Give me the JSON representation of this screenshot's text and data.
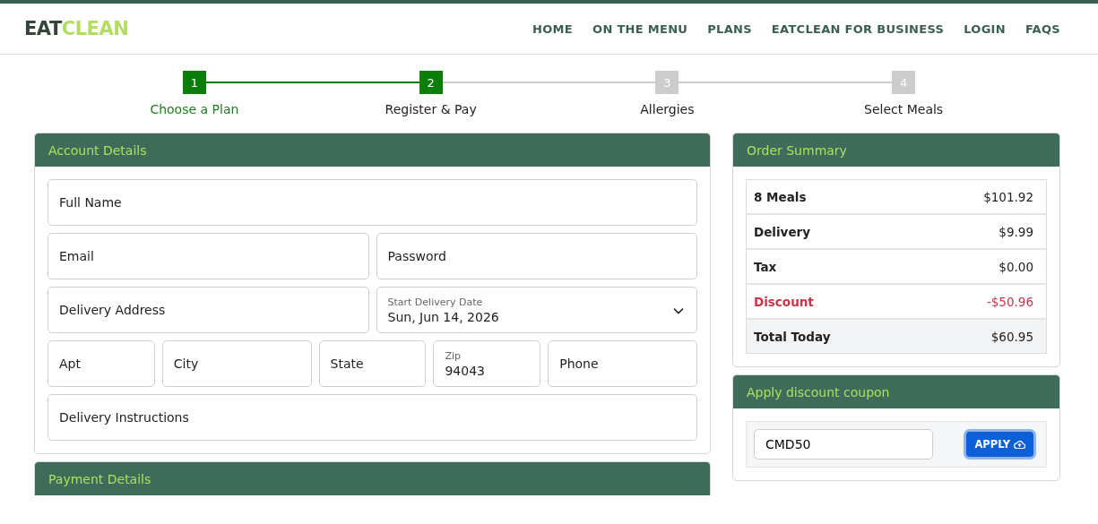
{
  "logo": {
    "dark": "EAT",
    "light": "CLEAN"
  },
  "nav": [
    "HOME",
    "ON THE MENU",
    "PLANS",
    "EATCLEAN FOR BUSINESS",
    "LOGIN",
    "FAQS"
  ],
  "steps": [
    {
      "number": "1",
      "label": "Choose a Plan",
      "done": true
    },
    {
      "number": "2",
      "label": "Register & Pay",
      "done": true
    },
    {
      "number": "3",
      "label": "Allergies",
      "done": false
    },
    {
      "number": "4",
      "label": "Select Meals",
      "done": false
    }
  ],
  "account": {
    "title": "Account Details",
    "rows": [
      [
        {
          "kind": "text",
          "placeholder": "Full Name"
        }
      ],
      [
        {
          "kind": "text",
          "placeholder": "Email"
        },
        {
          "kind": "text",
          "placeholder": "Password"
        }
      ],
      [
        {
          "kind": "text",
          "placeholder": "Delivery Address"
        },
        {
          "kind": "select",
          "label": "Start Delivery Date",
          "value": "Sun, Jun 14, 2026"
        }
      ],
      [
        {
          "kind": "text",
          "placeholder": "Apt"
        },
        {
          "kind": "text",
          "placeholder": "City"
        },
        {
          "kind": "text",
          "placeholder": "State"
        },
        {
          "kind": "floating",
          "label": "Zip",
          "value": "94043"
        },
        {
          "kind": "text",
          "placeholder": "Phone"
        }
      ],
      [
        {
          "kind": "text",
          "placeholder": "Delivery Instructions"
        }
      ]
    ]
  },
  "payment": {
    "title": "Payment Details"
  },
  "summary": {
    "title": "Order Summary",
    "rows": [
      {
        "kind": "normal",
        "label": "8 Meals",
        "amount": "$101.92"
      },
      {
        "kind": "normal",
        "label": "Delivery",
        "amount": "$9.99"
      },
      {
        "kind": "normal",
        "label": "Tax",
        "amount": "$0.00"
      },
      {
        "kind": "discount",
        "label": "Discount",
        "amount": "-$50.96"
      },
      {
        "kind": "total",
        "label": "Total Today",
        "amount": "$60.95"
      }
    ]
  },
  "coupon": {
    "title": "Apply discount coupon",
    "value": "CMD50",
    "button": "APPLY"
  }
}
